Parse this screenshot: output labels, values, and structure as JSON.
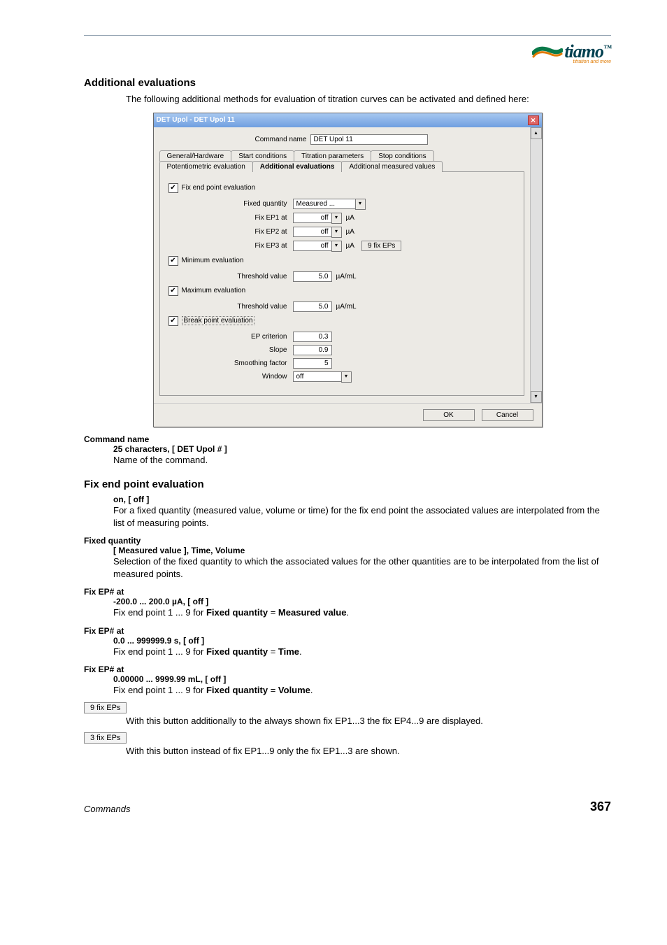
{
  "logo": {
    "brand": "tiamo",
    "tm": "™",
    "tagline": "titration and more"
  },
  "section1": {
    "title": "Additional evaluations",
    "intro": "The following additional methods for evaluation of titration curves can be activated and defined here:"
  },
  "dialog": {
    "title": "DET Upol - DET Upol 11",
    "cmd_label": "Command name",
    "cmd_value": "DET Upol 11",
    "tabs_row1": [
      "General/Hardware",
      "Start conditions",
      "Titration parameters",
      "Stop conditions"
    ],
    "tabs_row2": [
      "Potentiometric evaluation",
      "Additional evaluations",
      "Additional measured values"
    ],
    "fix_ep_chk": "Fix end point evaluation",
    "fixed_qty_label": "Fixed quantity",
    "fixed_qty_value": "Measured ...",
    "ep_rows": [
      {
        "label": "Fix EP1 at",
        "value": "off",
        "unit": "µA"
      },
      {
        "label": "Fix EP2 at",
        "value": "off",
        "unit": "µA"
      },
      {
        "label": "Fix EP3 at",
        "value": "off",
        "unit": "µA",
        "button": "9 fix EPs"
      }
    ],
    "min_chk": "Minimum evaluation",
    "min_label": "Threshold value",
    "min_value": "5.0",
    "min_unit": "µA/mL",
    "max_chk": "Maximum evaluation",
    "max_label": "Threshold value",
    "max_value": "5.0",
    "max_unit": "µA/mL",
    "break_chk": "Break point evaluation",
    "break_rows": [
      {
        "label": "EP criterion",
        "value": "0.3"
      },
      {
        "label": "Slope",
        "value": "0.9"
      },
      {
        "label": "Smoothing factor",
        "value": "5"
      }
    ],
    "window_label": "Window",
    "window_value": "off",
    "ok": "OK",
    "cancel": "Cancel"
  },
  "params": {
    "cmdname": {
      "label": "Command name",
      "range": "25 characters, [ DET Upol # ]",
      "desc": "Name of the command."
    }
  },
  "section2": {
    "title": "Fix end point evaluation",
    "top": {
      "range": "on, [ off ]",
      "desc": "For a fixed quantity (measured value, volume or time) for the fix end point the associated values are interpolated from the list of measuring points."
    },
    "fixedqty": {
      "label": "Fixed quantity",
      "range": "[ Measured value ], Time, Volume",
      "desc": "Selection of the fixed quantity to which the associated values for the other quantities are to be interpolated from the list of measured points."
    },
    "ep_mv": {
      "label": "Fix EP# at",
      "range": "-200.0 ... 200.0 µA, [ off ]",
      "desc_a": "Fix end point 1 ... 9 for ",
      "desc_b": "Fixed quantity",
      "desc_c": " = ",
      "desc_d": "Measured value",
      "desc_e": "."
    },
    "ep_time": {
      "label": "Fix EP# at",
      "range": "0.0 ... 999999.9 s, [ off ]",
      "desc_a": "Fix end point 1 ... 9 for ",
      "desc_b": "Fixed quantity",
      "desc_c": " = ",
      "desc_d": "Time",
      "desc_e": "."
    },
    "ep_vol": {
      "label": "Fix EP# at",
      "range": "0.00000 ... 9999.99 mL, [ off ]",
      "desc_a": "Fix end point 1 ... 9 for ",
      "desc_b": "Fixed quantity",
      "desc_c": " = ",
      "desc_d": "Volume",
      "desc_e": "."
    },
    "btn9": {
      "label": "9 fix EPs",
      "desc": "With this button additionally to the always shown fix EP1...3 the fix EP4...9 are displayed."
    },
    "btn3": {
      "label": "3 fix EPs",
      "desc": "With this button instead of fix EP1...9 only the fix EP1...3 are shown."
    }
  },
  "footer": {
    "left": "Commands",
    "right": "367"
  }
}
